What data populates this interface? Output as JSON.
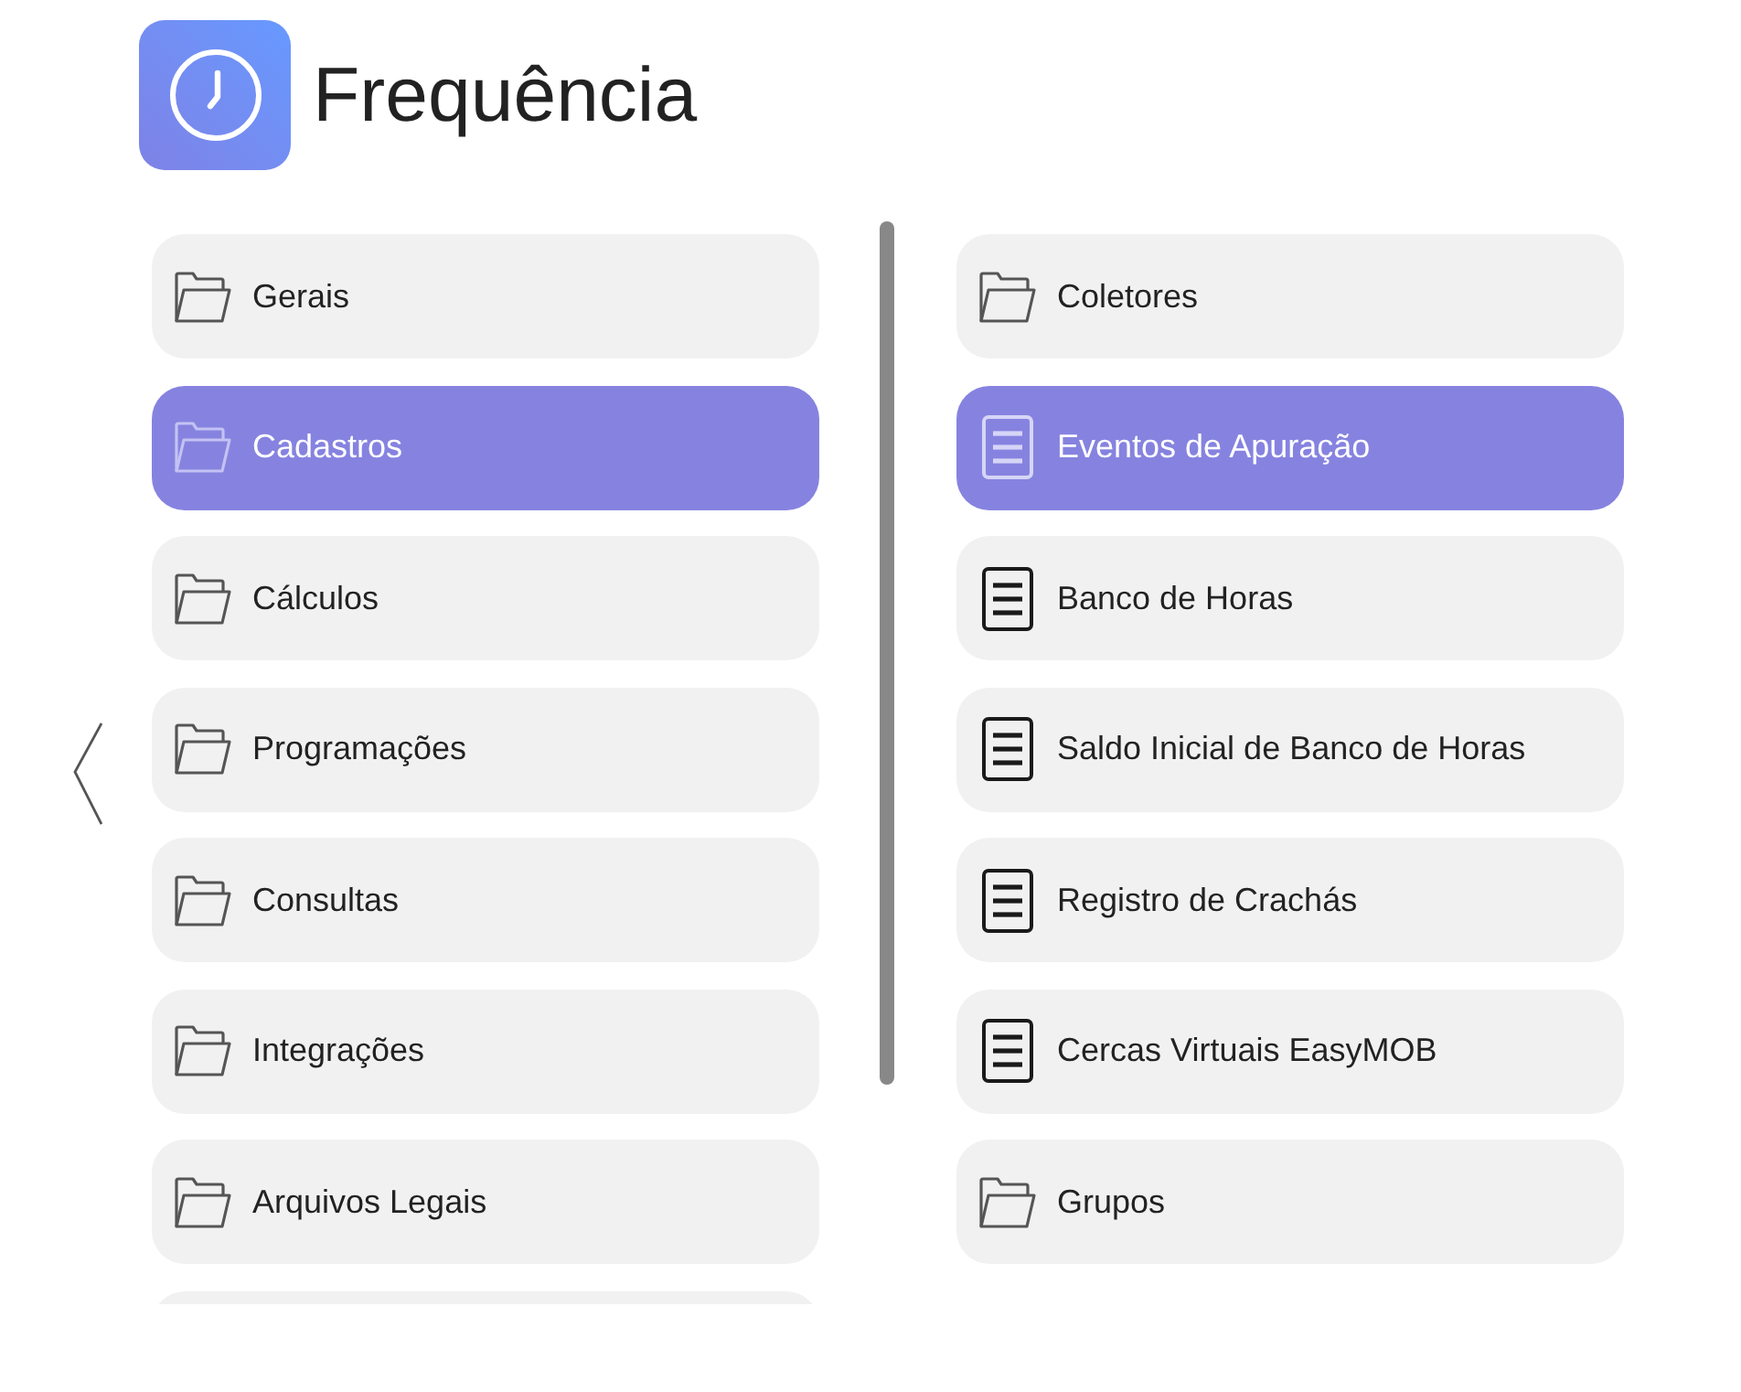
{
  "header": {
    "title": "Frequência"
  },
  "left_menu": {
    "items": [
      {
        "label": "Gerais",
        "kind": "folder",
        "selected": false
      },
      {
        "label": "Cadastros",
        "kind": "folder",
        "selected": true
      },
      {
        "label": "Cálculos",
        "kind": "folder",
        "selected": false
      },
      {
        "label": "Programações",
        "kind": "folder",
        "selected": false
      },
      {
        "label": "Consultas",
        "kind": "folder",
        "selected": false
      },
      {
        "label": "Integrações",
        "kind": "folder",
        "selected": false
      },
      {
        "label": "Arquivos Legais",
        "kind": "folder",
        "selected": false
      }
    ],
    "more_below": true
  },
  "right_menu": {
    "items": [
      {
        "label": "Coletores",
        "kind": "folder",
        "selected": false
      },
      {
        "label": "Eventos de Apuração",
        "kind": "document",
        "selected": true
      },
      {
        "label": "Banco de Horas",
        "kind": "document",
        "selected": false
      },
      {
        "label": "Saldo Inicial de Banco de Horas",
        "kind": "document",
        "selected": false
      },
      {
        "label": "Registro de Crachás",
        "kind": "document",
        "selected": false
      },
      {
        "label": "Cercas Virtuais EasyMOB",
        "kind": "document",
        "selected": false
      },
      {
        "label": "Grupos",
        "kind": "folder",
        "selected": false
      }
    ]
  }
}
